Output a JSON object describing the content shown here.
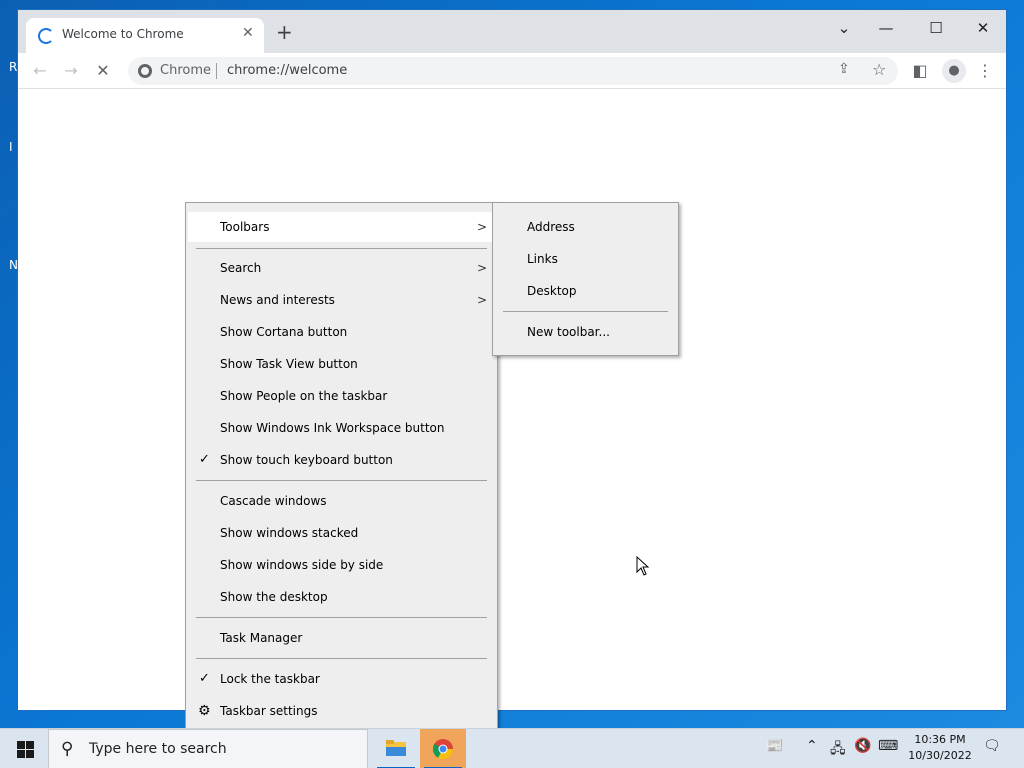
{
  "desktop": {
    "edge_letters": [
      "R",
      "I",
      "N"
    ]
  },
  "browser": {
    "tab_title": "Welcome to Chrome",
    "tab_close": "✕",
    "new_tab": "+",
    "controls": {
      "tab_search": "⌄",
      "minimize": "—",
      "maximize": "☐",
      "close": "✕"
    },
    "nav": {
      "back": "←",
      "forward": "→",
      "stop": "✕"
    },
    "omnibox": {
      "chip": "Chrome",
      "url": "chrome://welcome",
      "share": "⇪",
      "star": "☆"
    },
    "side_panel": "◧",
    "profile": "●",
    "menu": "⋮"
  },
  "context_menu": {
    "items": [
      {
        "label": "Toolbars",
        "submenu": true
      },
      {
        "label": "Search",
        "submenu": true
      },
      {
        "label": "News and interests",
        "submenu": true
      },
      {
        "label": "Show Cortana button"
      },
      {
        "label": "Show Task View button"
      },
      {
        "label": "Show People on the taskbar"
      },
      {
        "label": "Show Windows Ink Workspace button"
      },
      {
        "label": "Show touch keyboard button",
        "checked": true
      },
      {
        "label": "Cascade windows"
      },
      {
        "label": "Show windows stacked"
      },
      {
        "label": "Show windows side by side"
      },
      {
        "label": "Show the desktop"
      },
      {
        "label": "Task Manager"
      },
      {
        "label": "Lock the taskbar",
        "checked": true
      },
      {
        "label": "Taskbar settings",
        "icon": "gear-icon"
      }
    ],
    "check_glyph": "✓",
    "arrow_glyph": ">",
    "gear_glyph": "⚙"
  },
  "toolbars_submenu": {
    "items": [
      {
        "label": "Address"
      },
      {
        "label": "Links"
      },
      {
        "label": "Desktop"
      },
      {
        "label": "New toolbar..."
      }
    ]
  },
  "taskbar": {
    "search_placeholder": "Type here to search",
    "search_icon": "⚲",
    "tray": {
      "news": "📰",
      "chevron": "⌃",
      "network": "🖧",
      "volume": "🔇",
      "keyboard": "⌨",
      "notifications": "🗨"
    },
    "time": "10:36 PM",
    "date": "10/30/2022"
  },
  "colors": {
    "accent": "#1a73e8",
    "menu_bg": "#eeeeee",
    "menu_highlight": "#ffffff",
    "taskbar_bg": "#dbe5ef",
    "chrome_active_app": "#f0a55a"
  }
}
